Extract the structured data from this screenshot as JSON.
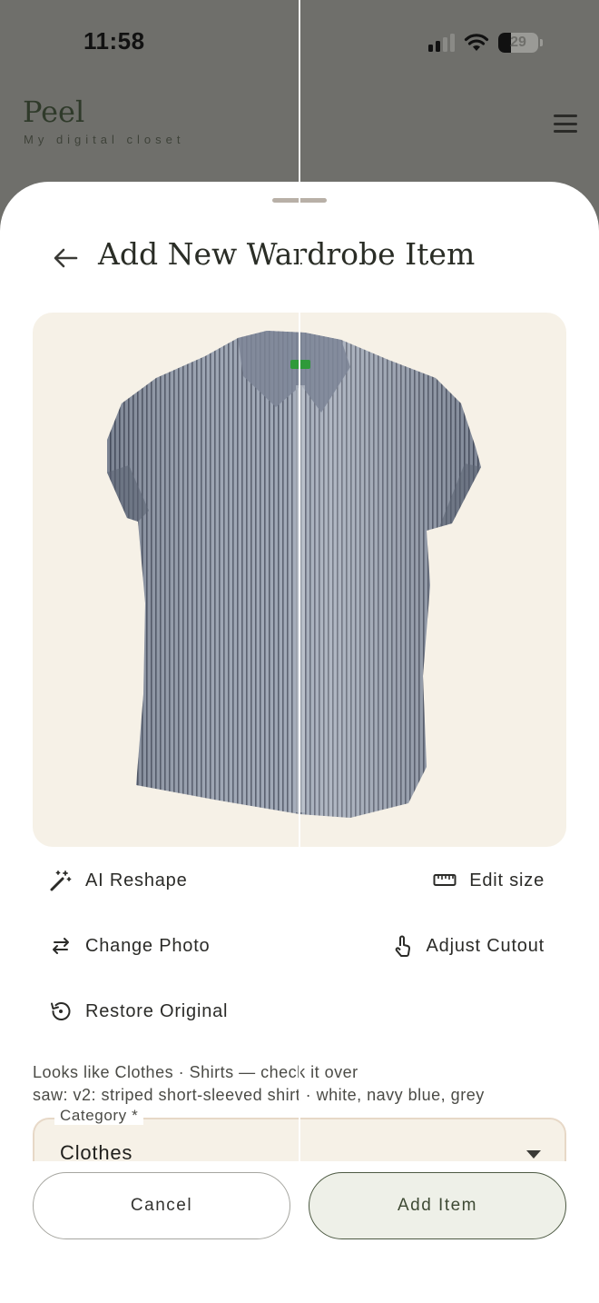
{
  "status_bar": {
    "time": "11:58",
    "battery": "29"
  },
  "app": {
    "brand": "Peel",
    "tagline": "My digital closet"
  },
  "sheet": {
    "title": "Add New Wardrobe Item"
  },
  "actions": {
    "ai_reshape": "AI Reshape",
    "edit_size": "Edit size",
    "change_photo": "Change Photo",
    "adjust_cutout": "Adjust Cutout",
    "restore_original": "Restore Original"
  },
  "detection": {
    "summary": "Looks like Clothes · Shirts — check it over",
    "saw": "saw: v2: striped short-sleeved shirt · white, navy blue, grey"
  },
  "category": {
    "label": "Category *",
    "value": "Clothes"
  },
  "buttons": {
    "cancel": "Cancel",
    "add": "Add Item"
  },
  "colors": {
    "sheet_bg": "#ffffff",
    "photo_bg": "#f6f1e7",
    "accent": "#4d5a43",
    "overlay": "#6f6f6b"
  },
  "icons": [
    "back-arrow-icon",
    "magic-wand-icon",
    "ruler-icon",
    "swap-arrows-icon",
    "touch-hand-icon",
    "restore-history-icon",
    "menu-icon",
    "dropdown-caret-icon"
  ]
}
